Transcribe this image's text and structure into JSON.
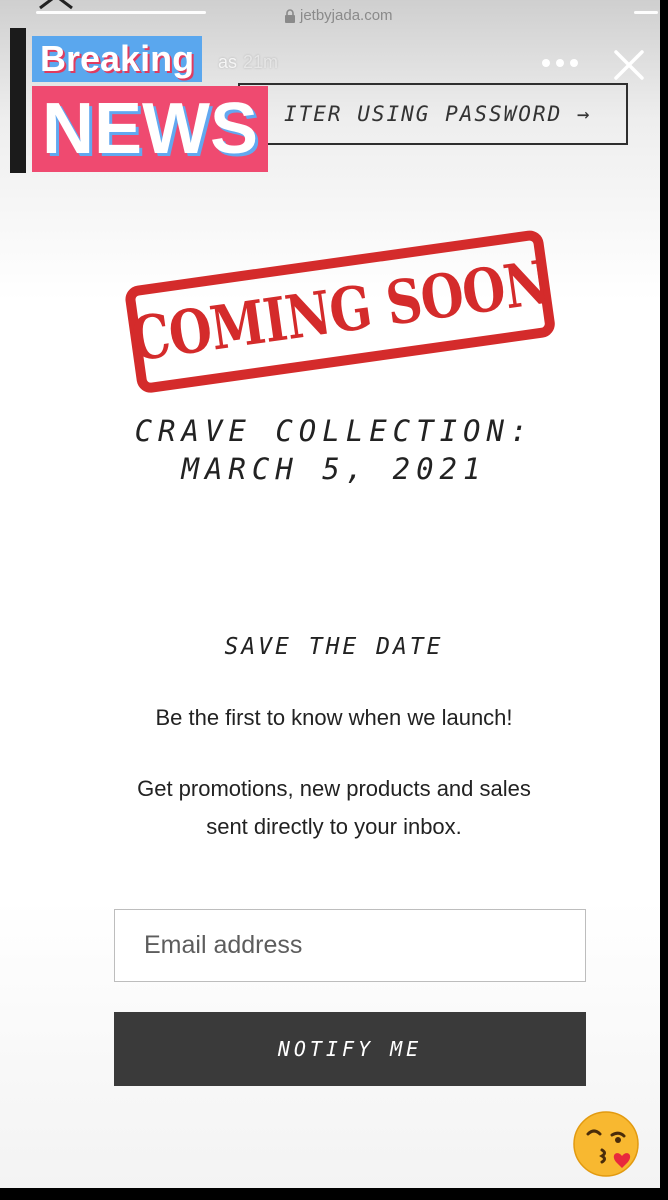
{
  "browser": {
    "url": "jetbyjada.com"
  },
  "story": {
    "username_fragment": "as",
    "time": "21m"
  },
  "sticker": {
    "line1": "Breaking",
    "line2": "NEWS"
  },
  "header": {
    "enter_label": "ITER USING PASSWORD →"
  },
  "stamp": {
    "text": "COMING SOON"
  },
  "collection": {
    "line1": "CRAVE COLLECTION:",
    "line2": "MARCH 5, 2021"
  },
  "signup": {
    "heading": "SAVE THE DATE",
    "tagline": "Be the first to know when we launch!",
    "desc_line1": "Get promotions, new products and sales",
    "desc_line2": "sent directly to your inbox.",
    "email_placeholder": "Email address",
    "button_label": "NOTIFY ME"
  },
  "colors": {
    "stamp_red": "#d42b2b",
    "breaking_blue": "#5aa7ee",
    "news_pink": "#ef4a70",
    "button_dark": "#3a3a3a"
  },
  "icons": [
    "back-chevron-icon",
    "lock-icon",
    "more-options-icon",
    "close-icon",
    "kissing-emoji-icon"
  ]
}
